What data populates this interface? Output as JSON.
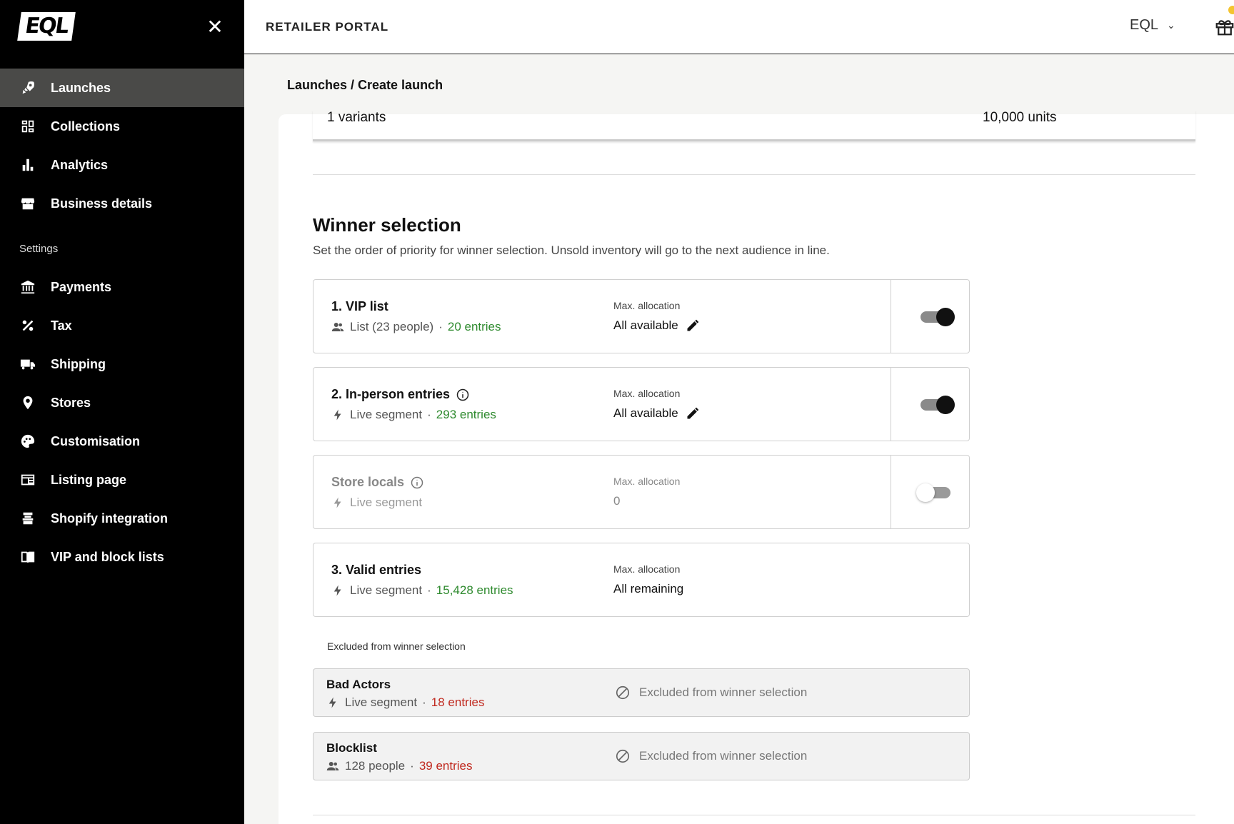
{
  "sidebar": {
    "logo": "EQL",
    "primary": [
      {
        "label": "Launches",
        "icon": "rocket-icon",
        "active": true
      },
      {
        "label": "Collections",
        "icon": "grid-icon"
      },
      {
        "label": "Analytics",
        "icon": "bar-chart-icon"
      },
      {
        "label": "Business details",
        "icon": "storefront-icon"
      }
    ],
    "settings_label": "Settings",
    "settings": [
      {
        "label": "Payments",
        "icon": "bank-icon"
      },
      {
        "label": "Tax",
        "icon": "percent-icon"
      },
      {
        "label": "Shipping",
        "icon": "truck-icon"
      },
      {
        "label": "Stores",
        "icon": "map-pin-icon"
      },
      {
        "label": "Customisation",
        "icon": "palette-icon"
      },
      {
        "label": "Listing page",
        "icon": "listing-icon"
      },
      {
        "label": "Shopify integration",
        "icon": "shopify-icon"
      },
      {
        "label": "VIP and block lists",
        "icon": "book-icon"
      }
    ]
  },
  "header": {
    "title": "RETAILER PORTAL",
    "account": "EQL"
  },
  "breadcrumb": "Launches / Create launch",
  "variants": {
    "left": "1 variants",
    "right": "10,000 units"
  },
  "winner": {
    "title": "Winner selection",
    "subtitle": "Set the order of priority for winner selection. Unsold inventory will go to the next audience in line.",
    "alloc_label": "Max. allocation",
    "rows": [
      {
        "name": "1. VIP list",
        "type": "List (23 people)",
        "entries": "20 entries",
        "alloc": "All available",
        "enabled": true
      },
      {
        "name": "2. In-person entries",
        "type": "Live segment",
        "entries": "293 entries",
        "alloc": "All available",
        "enabled": true
      },
      {
        "name": "Store locals",
        "type": "Live segment",
        "entries": "",
        "alloc": "0",
        "enabled": false
      },
      {
        "name": "3. Valid entries",
        "type": "Live segment",
        "entries": "15,428 entries",
        "alloc": "All remaining"
      }
    ],
    "excluded_label": "Excluded from winner selection",
    "excluded": [
      {
        "name": "Bad Actors",
        "type": "Live segment",
        "entries": "18 entries",
        "status": "Excluded from winner selection"
      },
      {
        "name": "Blocklist",
        "type": "128 people",
        "entries": "39 entries",
        "status": "Excluded from winner selection"
      }
    ]
  },
  "colors": {
    "green": "#2e8a2e",
    "red": "#c0281e",
    "sidebar_bg": "#000000",
    "active_bg": "#4a4a48"
  }
}
